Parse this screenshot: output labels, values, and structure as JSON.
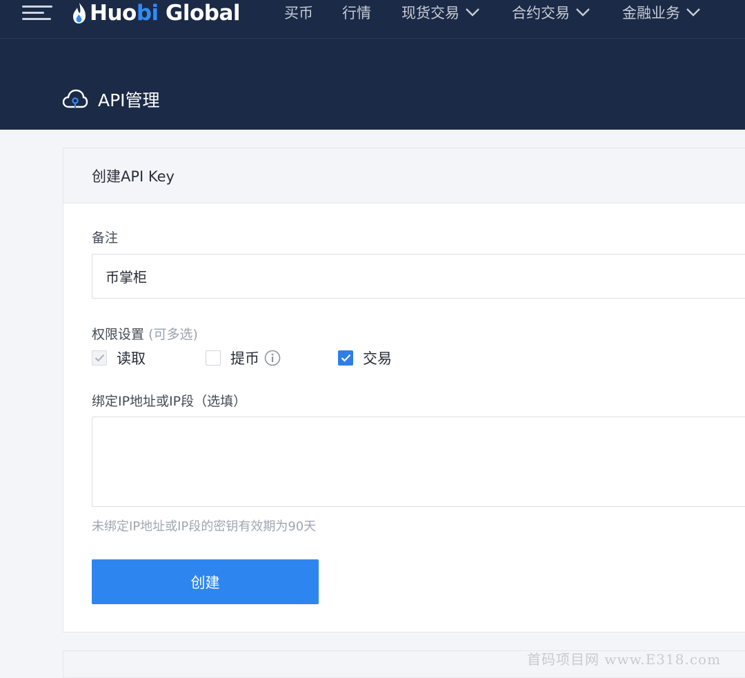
{
  "topbar": {
    "logo": {
      "part1": "Huo",
      "part2": "bi",
      "part3": " Global"
    },
    "nav": [
      {
        "label": "买币",
        "dropdown": false
      },
      {
        "label": "行情",
        "dropdown": false
      },
      {
        "label": "现货交易",
        "dropdown": true
      },
      {
        "label": "合约交易",
        "dropdown": true
      },
      {
        "label": "金融业务",
        "dropdown": true
      }
    ]
  },
  "page": {
    "title": "API管理"
  },
  "card": {
    "title": "创建API Key",
    "note": {
      "label": "备注",
      "value": "币掌柜"
    },
    "permissions": {
      "label": "权限设置",
      "label_hint": "(可多选)",
      "options": [
        {
          "label": "读取",
          "checked": true,
          "disabled": true
        },
        {
          "label": "提币",
          "checked": false,
          "disabled": false
        },
        {
          "label": "交易",
          "checked": true,
          "disabled": false
        }
      ]
    },
    "ip": {
      "label": "绑定IP地址或IP段（选填）",
      "value": ""
    },
    "hint": "未绑定IP地址或IP段的密钥有效期为90天",
    "submit_label": "创建"
  },
  "watermark": "首码项目网 www.E318.com",
  "colors": {
    "nav_bg": "#1b2a46",
    "brand_blue": "#2f8cf5",
    "button_blue": "#2d86f0",
    "checkbox_blue": "#2f7ee8"
  }
}
